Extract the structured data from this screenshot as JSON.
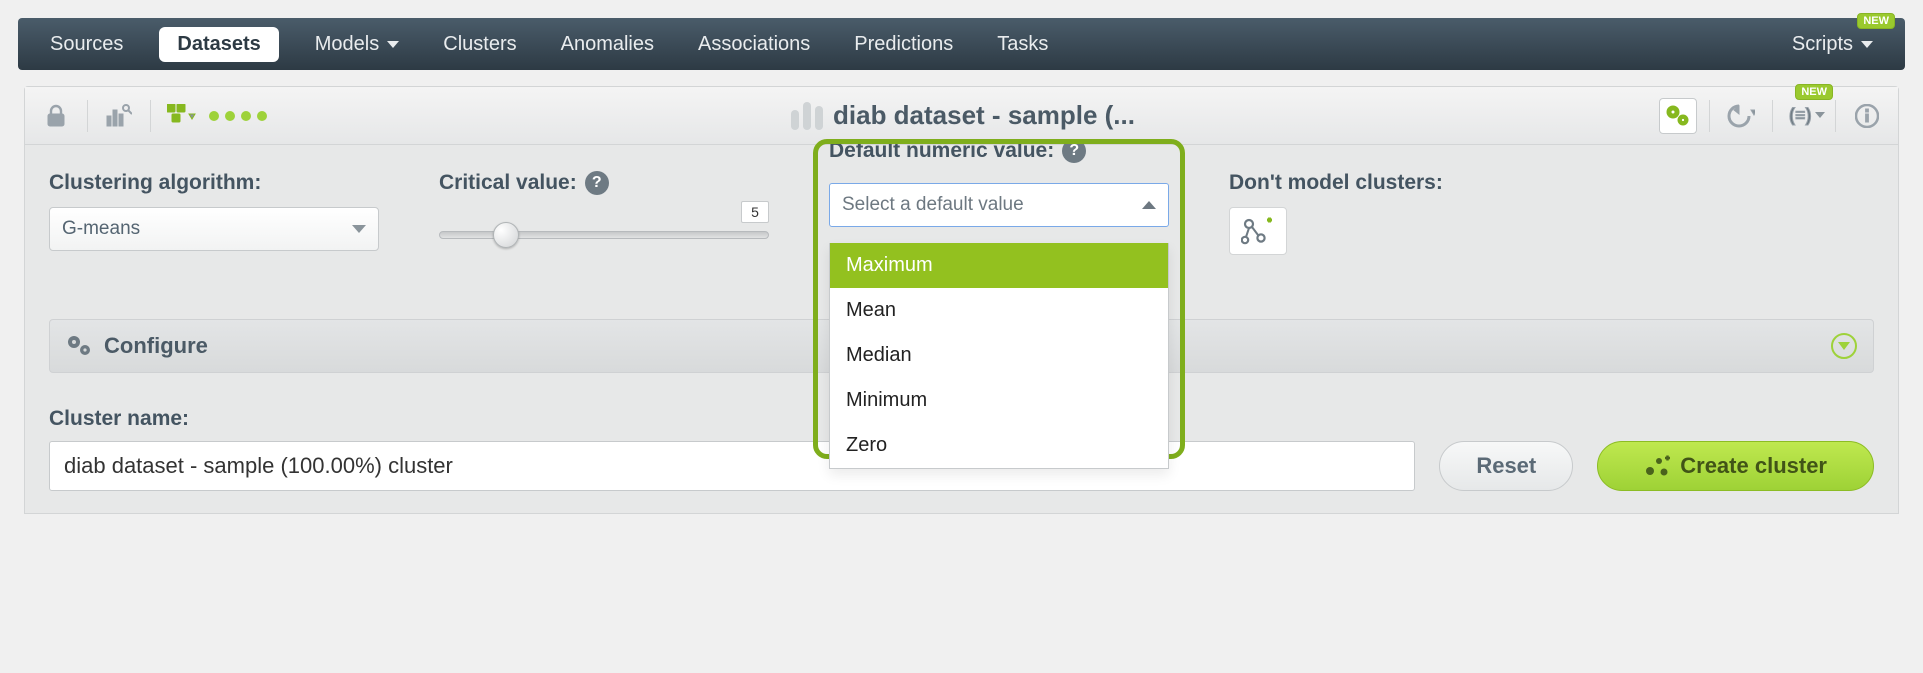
{
  "nav": {
    "sources": "Sources",
    "datasets": "Datasets",
    "models": "Models",
    "clusters": "Clusters",
    "anomalies": "Anomalies",
    "associations": "Associations",
    "predictions": "Predictions",
    "tasks": "Tasks",
    "scripts": "Scripts",
    "new_badge": "NEW"
  },
  "subbar": {
    "title": "diab dataset - sample (..."
  },
  "config": {
    "algorithm_label": "Clustering algorithm:",
    "algorithm_value": "G-means",
    "critical_label": "Critical value:",
    "critical_value": "5",
    "default_numeric_label": "Default numeric value:",
    "default_numeric_placeholder": "Select a default value",
    "default_numeric_options": {
      "maximum": "Maximum",
      "mean": "Mean",
      "median": "Median",
      "minimum": "Minimum",
      "zero": "Zero"
    },
    "dont_model_label": "Don't model clusters:"
  },
  "configure_section": "Configure",
  "bottom": {
    "cluster_name_label": "Cluster name:",
    "cluster_name_value": "diab dataset - sample (100.00%) cluster",
    "reset": "Reset",
    "create": "Create cluster"
  }
}
